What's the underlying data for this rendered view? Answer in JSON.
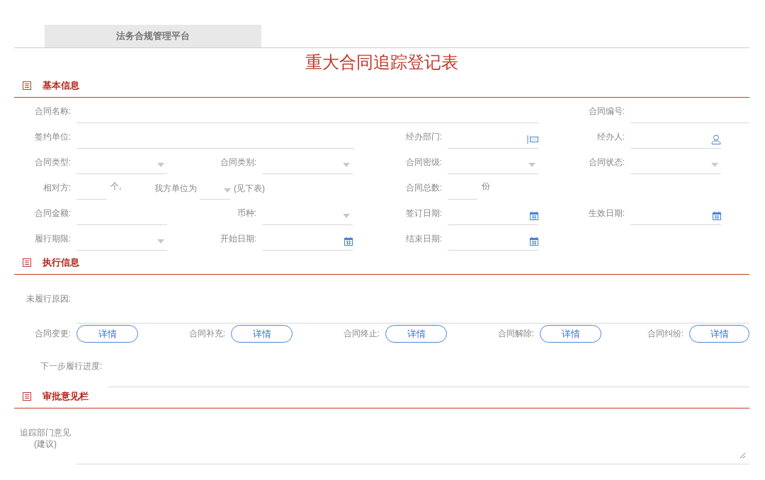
{
  "platform_tab": {
    "label": "法务合规管理平台",
    "selected": true
  },
  "title": "重大合同追踪登记表",
  "sections": [
    {
      "kind": "grid",
      "title": "基本信息",
      "rows": [
        [
          {
            "kind": "text",
            "label": "合同名称:"
          },
          "",
          "",
          {
            "kind": "text",
            "label": "合同编号:"
          }
        ],
        [
          {
            "kind": "text",
            "label": "签约单位:"
          },
          "",
          {
            "kind": "org",
            "label": "经办部门:"
          },
          {
            "kind": "person",
            "label": "经办人:"
          }
        ],
        [
          {
            "kind": "select",
            "label": "合同类型:"
          },
          {
            "kind": "select",
            "label": "合同类别:"
          },
          {
            "kind": "select",
            "label": "合同密级:"
          },
          {
            "kind": "select",
            "label": "合同状态:"
          }
        ],
        [
          {
            "kind": "count",
            "label": "相对方:",
            "unit": "个,"
          },
          {
            "kind": "inline_select",
            "label": "我方单位为",
            "note": "(见下表)"
          },
          {
            "kind": "count",
            "label": "合同总数:",
            "unit": "份"
          }
        ],
        [
          {
            "kind": "text_short",
            "label": "合同金额:"
          },
          {
            "kind": "select",
            "label": "币种:"
          },
          {
            "kind": "date",
            "label": "签订日期:"
          },
          {
            "kind": "date",
            "label": "生效日期:"
          }
        ],
        [
          {
            "kind": "select",
            "label": "履行期限:"
          },
          {
            "kind": "date",
            "label": "开始日期:"
          },
          {
            "kind": "date",
            "label": "结束日期:"
          }
        ]
      ]
    },
    {
      "kind": "execution",
      "title": "执行信息",
      "reason_label": "未履行原因:",
      "actions": [
        {
          "label": "合同变更:",
          "button": "详情"
        },
        {
          "label": "合同补充:",
          "button": "详情"
        },
        {
          "label": "合同终止:",
          "button": "详情"
        },
        {
          "label": "合同解除:",
          "button": "详情"
        },
        {
          "label": "合同纠纷:",
          "button": "详情"
        }
      ],
      "progress_label": "下一步履行进度:"
    },
    {
      "kind": "approval",
      "title": "审批意见栏",
      "opinion_label": "追踪部门意见(建议)"
    }
  ]
}
